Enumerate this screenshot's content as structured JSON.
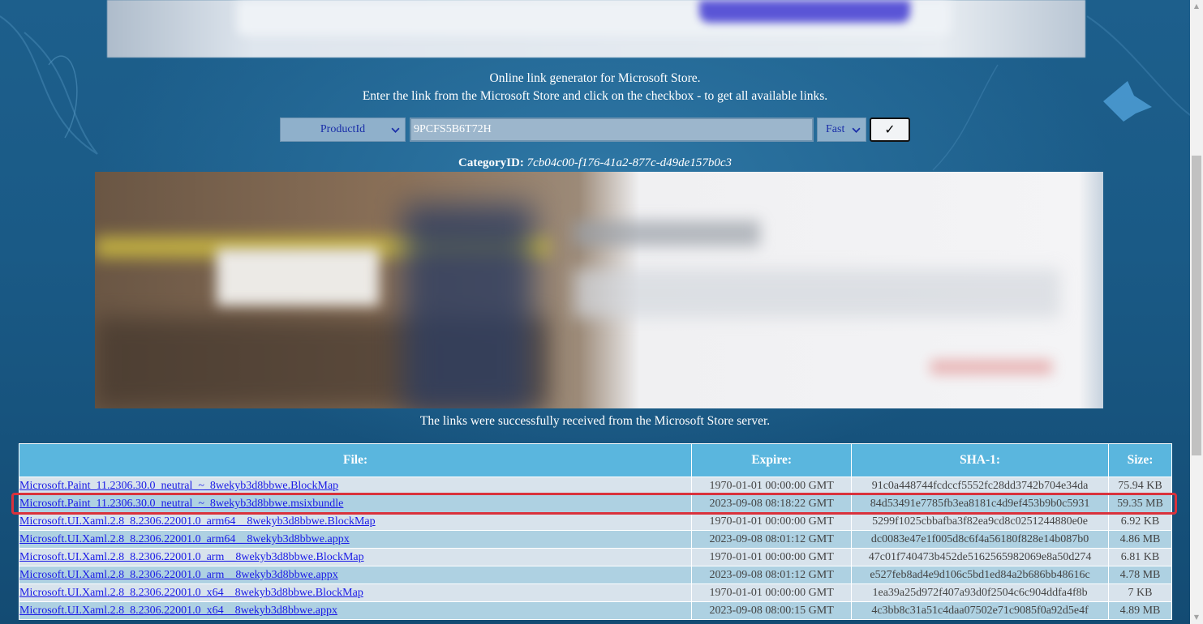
{
  "header": {
    "line1": "Online link generator for Microsoft Store.",
    "line2": "Enter the link from the Microsoft Store and click on the checkbox - to get all available links."
  },
  "form": {
    "type_select": "ProductId",
    "url_value": "9PCFS5B6T72H",
    "speed_select": "Fast",
    "submit_label": "✓"
  },
  "category": {
    "label": "CategoryID:",
    "value": "7cb04c00-f176-41a2-877c-d49de157b0c3"
  },
  "status_message": "The links were successfully received from the Microsoft Store server.",
  "table": {
    "headers": {
      "file": "File:",
      "expire": "Expire:",
      "sha1": "SHA-1:",
      "size": "Size:"
    },
    "rows": [
      {
        "file": "Microsoft.Paint_11.2306.30.0_neutral_~_8wekyb3d8bbwe.BlockMap",
        "expire": "1970-01-01 00:00:00 GMT",
        "sha1": "91c0a448744fcdccf5552fc28dd3742b704e34da",
        "size": "75.94 KB"
      },
      {
        "file": "Microsoft.Paint_11.2306.30.0_neutral_~_8wekyb3d8bbwe.msixbundle",
        "expire": "2023-09-08 08:18:22 GMT",
        "sha1": "84d53491e7785fb3ea8181c4d9ef453b9b0c5931",
        "size": "59.35 MB"
      },
      {
        "file": "Microsoft.UI.Xaml.2.8_8.2306.22001.0_arm64__8wekyb3d8bbwe.BlockMap",
        "expire": "1970-01-01 00:00:00 GMT",
        "sha1": "5299f1025cbbafba3f82ea9cd8c0251244880e0e",
        "size": "6.92 KB"
      },
      {
        "file": "Microsoft.UI.Xaml.2.8_8.2306.22001.0_arm64__8wekyb3d8bbwe.appx",
        "expire": "2023-09-08 08:01:12 GMT",
        "sha1": "dc0083e47e1f005d8c6f4a56180f828e14b087b0",
        "size": "4.86 MB"
      },
      {
        "file": "Microsoft.UI.Xaml.2.8_8.2306.22001.0_arm__8wekyb3d8bbwe.BlockMap",
        "expire": "1970-01-01 00:00:00 GMT",
        "sha1": "47c01f740473b452de5162565982069e8a50d274",
        "size": "6.81 KB"
      },
      {
        "file": "Microsoft.UI.Xaml.2.8_8.2306.22001.0_arm__8wekyb3d8bbwe.appx",
        "expire": "2023-09-08 08:01:12 GMT",
        "sha1": "e527feb8ad4e9d106c5bd1ed84a2b686bb48616c",
        "size": "4.78 MB"
      },
      {
        "file": "Microsoft.UI.Xaml.2.8_8.2306.22001.0_x64__8wekyb3d8bbwe.BlockMap",
        "expire": "1970-01-01 00:00:00 GMT",
        "sha1": "1ea39a25d972f407a93d0f2504c6c904ddfa4f8b",
        "size": "7 KB"
      },
      {
        "file": "Microsoft.UI.Xaml.2.8_8.2306.22001.0_x64__8wekyb3d8bbwe.appx",
        "expire": "2023-09-08 08:00:15 GMT",
        "sha1": "4c3bb8c31a51c4daa07502e71c9085f0a92d5e4f",
        "size": "4.89 MB"
      }
    ]
  },
  "colors": {
    "background": "#1a5a86",
    "table_header": "#5ab6de",
    "row_odd": "#d8e3ec",
    "row_even": "#aed1e2",
    "link": "#1a1ae6",
    "highlight": "#d9323c"
  }
}
